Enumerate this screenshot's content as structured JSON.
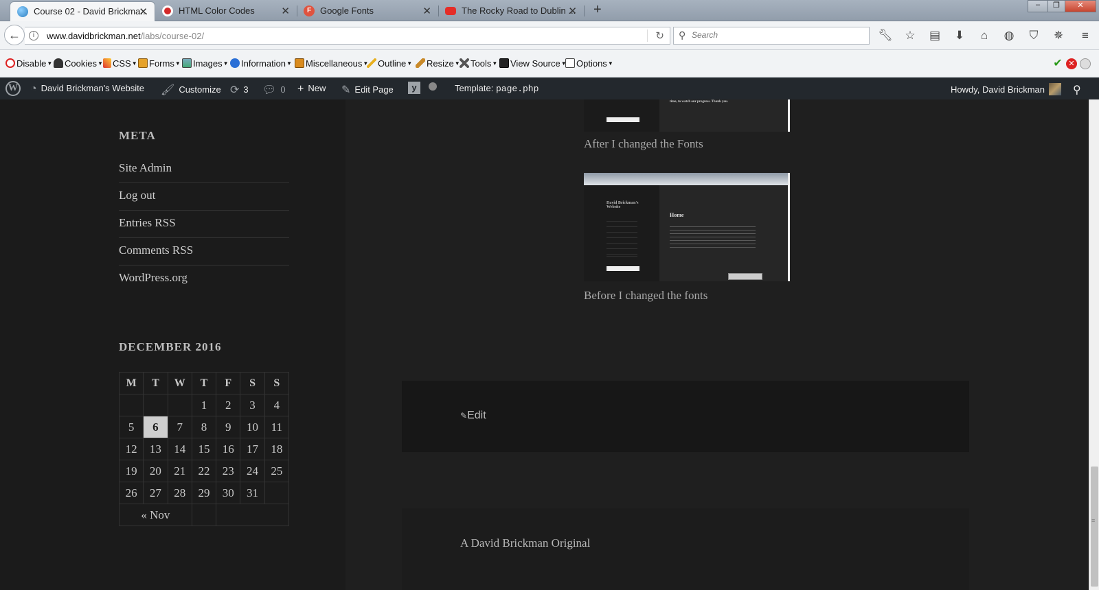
{
  "browser": {
    "tabs": [
      {
        "title": "Course 02 - David Brickma...",
        "active": true,
        "favicon": "globe-icon"
      },
      {
        "title": "HTML Color Codes",
        "favicon": "color-codes-icon"
      },
      {
        "title": "Google Fonts",
        "favicon": "google-fonts-icon"
      },
      {
        "title": "The Rocky Road to Dublin ...",
        "favicon": "youtube-icon"
      }
    ],
    "url_domain": "www.davidbrickman.net",
    "url_path": "/labs/course-02/",
    "search_placeholder": "Search"
  },
  "devtoolbar": {
    "items": [
      "Disable",
      "Cookies",
      "CSS",
      "Forms",
      "Images",
      "Information",
      "Miscellaneous",
      "Outline",
      "Resize",
      "Tools",
      "View Source",
      "Options"
    ]
  },
  "adminbar": {
    "site_name": "David Brickman's Website",
    "customize": "Customize",
    "updates_count": "3",
    "comments_count": "0",
    "new_label": "New",
    "edit_page": "Edit Page",
    "template_label": "Template:",
    "template_file": "page.php",
    "howdy": "Howdy, David Brickman"
  },
  "sidebar": {
    "meta_title": "META",
    "meta_links": [
      "Site Admin",
      "Log out",
      "Entries RSS",
      "Comments RSS",
      "WordPress.org"
    ],
    "calendar": {
      "caption": "DECEMBER 2016",
      "days": [
        "M",
        "T",
        "W",
        "T",
        "F",
        "S",
        "S"
      ],
      "weeks": [
        [
          "",
          "",
          "",
          "1",
          "2",
          "3",
          "4"
        ],
        [
          "5",
          "6",
          "7",
          "8",
          "9",
          "10",
          "11"
        ],
        [
          "12",
          "13",
          "14",
          "15",
          "16",
          "17",
          "18"
        ],
        [
          "19",
          "20",
          "21",
          "22",
          "23",
          "24",
          "25"
        ],
        [
          "26",
          "27",
          "28",
          "29",
          "30",
          "31",
          ""
        ]
      ],
      "today": "6",
      "prev_link": "« Nov"
    }
  },
  "content": {
    "caption_after": "After I changed the Fonts",
    "caption_before": "Before I changed the fonts",
    "thumb_site_title": "David Brickman's Website",
    "thumb_heading": "Home",
    "thumb_thanks": "time, to watch our progress. Thank you.",
    "edit_link": "Edit",
    "footer": "A David Brickman Original"
  },
  "colors": {
    "admin_bar": "#23282d",
    "page_bg": "#1b1b1b",
    "content_bg": "#1f1f1f"
  }
}
